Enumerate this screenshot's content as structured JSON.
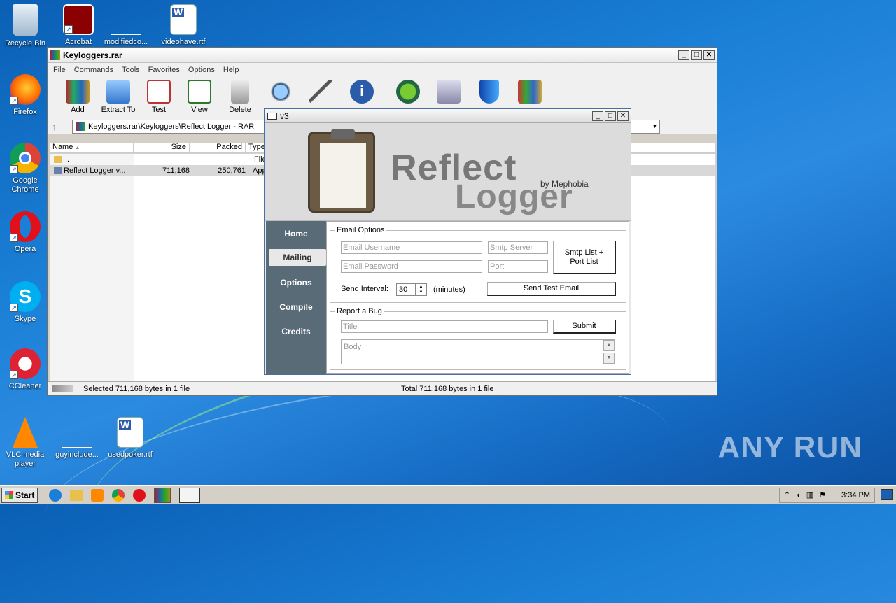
{
  "desktop": {
    "icons": [
      {
        "label": "Recycle Bin"
      },
      {
        "label": "Acrobat"
      },
      {
        "label": "modifiedco..."
      },
      {
        "label": "videohave.rtf"
      },
      {
        "label": "Firefox"
      },
      {
        "label": "Google Chrome"
      },
      {
        "label": "Opera"
      },
      {
        "label": "Skype"
      },
      {
        "label": "CCleaner"
      },
      {
        "label": "VLC media player"
      },
      {
        "label": "guyinclude..."
      },
      {
        "label": "usedpoker.rtf"
      }
    ],
    "watermark": "ANY RUN"
  },
  "rar_window": {
    "title": "Keyloggers.rar",
    "menu": [
      "File",
      "Commands",
      "Tools",
      "Favorites",
      "Options",
      "Help"
    ],
    "toolbar": [
      "Add",
      "Extract To",
      "Test",
      "View",
      "Delete"
    ],
    "address": "Keyloggers.rar\\Keyloggers\\Reflect Logger - RAR",
    "columns": [
      "Name",
      "Size",
      "Packed",
      "Type"
    ],
    "rows": [
      {
        "name": "..",
        "size": "",
        "packed": "",
        "type": "File"
      },
      {
        "name": "Reflect Logger v...",
        "size": "711,168",
        "packed": "250,761",
        "type": "App"
      }
    ],
    "status_left": "Selected 711,168 bytes in 1 file",
    "status_right": "Total 711,168 bytes in 1 file"
  },
  "dialog": {
    "title": "v3",
    "brand_line1": "Reflect",
    "brand_line2": "Logger",
    "brand_by": "by Mephobia",
    "nav": [
      "Home",
      "Mailing",
      "Options",
      "Compile",
      "Credits"
    ],
    "active_nav": "Mailing",
    "email_options": {
      "legend": "Email Options",
      "username_placeholder": "Email Username",
      "password_placeholder": "Email Password",
      "smtp_placeholder": "Smtp Server",
      "port_placeholder": "Port",
      "smtp_list_button": "Smtp List + Port List",
      "interval_label": "Send Interval:",
      "interval_value": "30",
      "interval_unit": "(minutes)",
      "send_test_button": "Send Test Email"
    },
    "report_bug": {
      "legend": "Report a Bug",
      "title_placeholder": "Title",
      "submit_button": "Submit",
      "body_placeholder": "Body"
    }
  },
  "taskbar": {
    "start_label": "Start",
    "clock": "3:34 PM"
  }
}
